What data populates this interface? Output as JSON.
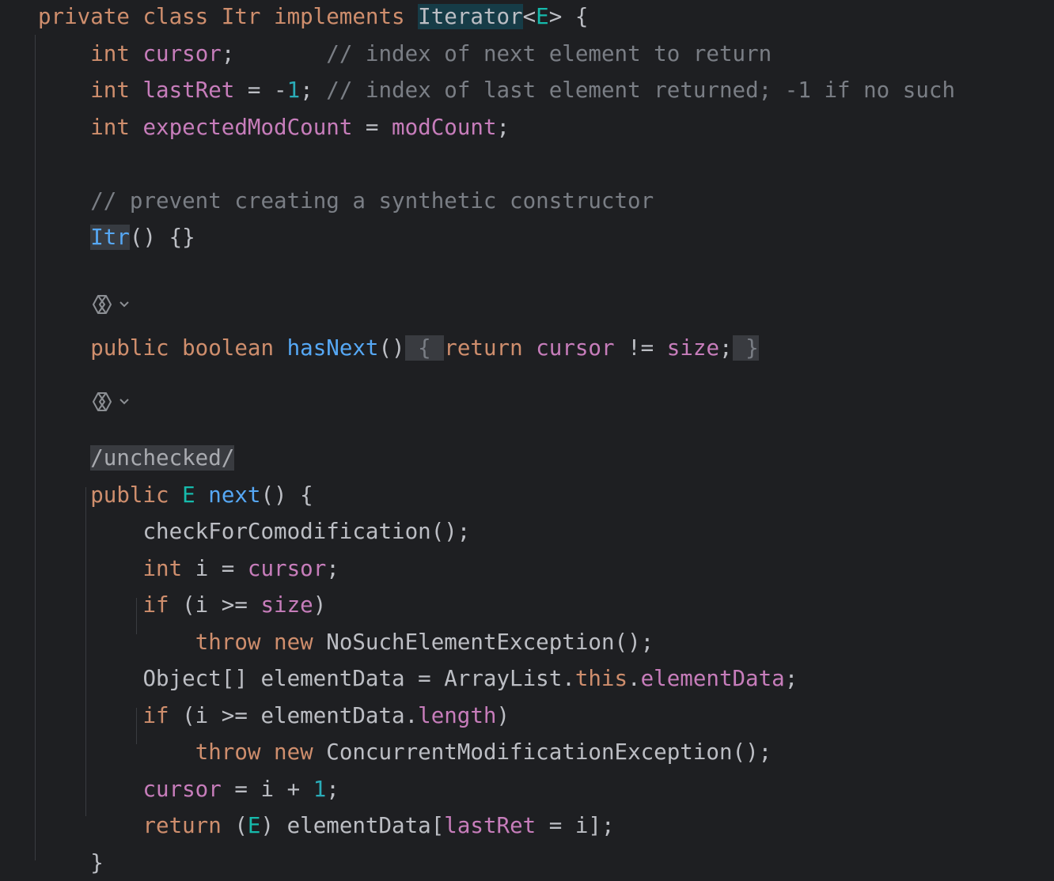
{
  "colors": {
    "background": "#1e1f22",
    "keyword": "#cf8e6d",
    "field": "#c77dbb",
    "comment": "#7a7e85",
    "number": "#2aacb8",
    "method": "#56a8f5",
    "type_param": "#16baac",
    "plain": "#bcbec4",
    "identifier_highlight": "#163c47"
  },
  "inlay_hints": [
    {
      "icon": "ai-assistant-icon",
      "chevron": "chevron-down-icon"
    },
    {
      "icon": "ai-assistant-icon",
      "chevron": "chevron-down-icon"
    }
  ],
  "code_lines": [
    [
      {
        "t": "private class Itr implements ",
        "c": "kw"
      },
      {
        "t": "Iterator",
        "c": "pl hl"
      },
      {
        "t": "<",
        "c": "pl"
      },
      {
        "t": "E",
        "c": "tp"
      },
      {
        "t": "> {",
        "c": "pl"
      }
    ],
    [
      {
        "t": "    ",
        "c": "pl"
      },
      {
        "t": "int ",
        "c": "kw"
      },
      {
        "t": "cursor",
        "c": "fld"
      },
      {
        "t": ";       ",
        "c": "pl"
      },
      {
        "t": "// index of next element to return",
        "c": "cm"
      }
    ],
    [
      {
        "t": "    ",
        "c": "pl"
      },
      {
        "t": "int ",
        "c": "kw"
      },
      {
        "t": "lastRet",
        "c": "fld"
      },
      {
        "t": " = -",
        "c": "pl"
      },
      {
        "t": "1",
        "c": "num"
      },
      {
        "t": "; ",
        "c": "pl"
      },
      {
        "t": "// index of last element returned; -1 if no such",
        "c": "cm"
      }
    ],
    [
      {
        "t": "    ",
        "c": "pl"
      },
      {
        "t": "int ",
        "c": "kw"
      },
      {
        "t": "expectedModCount",
        "c": "fld"
      },
      {
        "t": " = ",
        "c": "pl"
      },
      {
        "t": "modCount",
        "c": "fld"
      },
      {
        "t": ";",
        "c": "pl"
      }
    ],
    [],
    [
      {
        "t": "    ",
        "c": "pl"
      },
      {
        "t": "// prevent creating a synthetic constructor",
        "c": "cm"
      }
    ],
    [
      {
        "t": "    ",
        "c": "pl"
      },
      {
        "t": "Itr",
        "c": "fn hl2"
      },
      {
        "t": "() {}",
        "c": "pl"
      }
    ],
    [],
    [],
    [
      {
        "t": "    ",
        "c": "pl"
      },
      {
        "t": "public boolean ",
        "c": "kw"
      },
      {
        "t": "hasNext",
        "c": "fn"
      },
      {
        "t": "()",
        "c": "pl"
      },
      {
        "t": " { ",
        "c": "fold"
      },
      {
        "t": "return ",
        "c": "kw"
      },
      {
        "t": "cursor",
        "c": "fld"
      },
      {
        "t": " != ",
        "c": "pl"
      },
      {
        "t": "size",
        "c": "fld"
      },
      {
        "t": ";",
        "c": "pl"
      },
      {
        "t": " }",
        "c": "fold"
      }
    ],
    [],
    [],
    [
      {
        "t": "    ",
        "c": "pl"
      },
      {
        "t": "/unchecked/",
        "c": "ann"
      }
    ],
    [
      {
        "t": "    ",
        "c": "pl"
      },
      {
        "t": "public ",
        "c": "kw"
      },
      {
        "t": "E ",
        "c": "tp"
      },
      {
        "t": "next",
        "c": "fn"
      },
      {
        "t": "() {",
        "c": "pl"
      }
    ],
    [
      {
        "t": "        checkForComodification();",
        "c": "pl"
      }
    ],
    [
      {
        "t": "        ",
        "c": "pl"
      },
      {
        "t": "int ",
        "c": "kw"
      },
      {
        "t": "i = ",
        "c": "pl"
      },
      {
        "t": "cursor",
        "c": "fld"
      },
      {
        "t": ";",
        "c": "pl"
      }
    ],
    [
      {
        "t": "        ",
        "c": "pl"
      },
      {
        "t": "if ",
        "c": "kw"
      },
      {
        "t": "(i >= ",
        "c": "pl"
      },
      {
        "t": "size",
        "c": "fld"
      },
      {
        "t": ")",
        "c": "pl"
      }
    ],
    [
      {
        "t": "            ",
        "c": "pl"
      },
      {
        "t": "throw new ",
        "c": "kw"
      },
      {
        "t": "NoSuchElementException();",
        "c": "pl"
      }
    ],
    [
      {
        "t": "        Object[] elementData = ArrayList.",
        "c": "pl"
      },
      {
        "t": "this",
        "c": "kw"
      },
      {
        "t": ".",
        "c": "pl"
      },
      {
        "t": "elementData",
        "c": "fld"
      },
      {
        "t": ";",
        "c": "pl"
      }
    ],
    [
      {
        "t": "        ",
        "c": "pl"
      },
      {
        "t": "if ",
        "c": "kw"
      },
      {
        "t": "(i >= elementData.",
        "c": "pl"
      },
      {
        "t": "length",
        "c": "fld"
      },
      {
        "t": ")",
        "c": "pl"
      }
    ],
    [
      {
        "t": "            ",
        "c": "pl"
      },
      {
        "t": "throw new ",
        "c": "kw"
      },
      {
        "t": "ConcurrentModificationException();",
        "c": "pl"
      }
    ],
    [
      {
        "t": "        ",
        "c": "pl"
      },
      {
        "t": "cursor",
        "c": "fld"
      },
      {
        "t": " = i + ",
        "c": "pl"
      },
      {
        "t": "1",
        "c": "num"
      },
      {
        "t": ";",
        "c": "pl"
      }
    ],
    [
      {
        "t": "        ",
        "c": "pl"
      },
      {
        "t": "return ",
        "c": "kw"
      },
      {
        "t": "(",
        "c": "pl"
      },
      {
        "t": "E",
        "c": "tp"
      },
      {
        "t": ") elementData[",
        "c": "pl"
      },
      {
        "t": "lastRet",
        "c": "fld"
      },
      {
        "t": " = i];",
        "c": "pl"
      }
    ],
    [
      {
        "t": "    }",
        "c": "pl"
      }
    ]
  ]
}
